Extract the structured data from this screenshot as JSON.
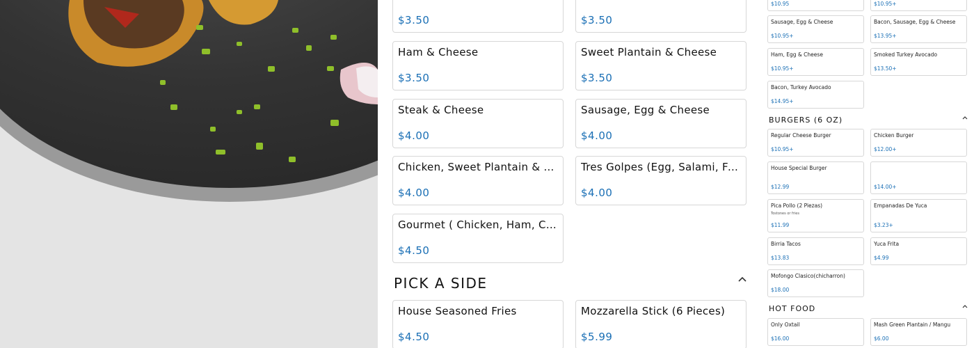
{
  "middle": {
    "items": [
      {
        "name": "",
        "price": "$3.50"
      },
      {
        "name": "",
        "price": "$3.50"
      },
      {
        "name": "Ham & Cheese",
        "price": "$3.50"
      },
      {
        "name": "Sweet Plantain & Cheese",
        "price": "$3.50"
      },
      {
        "name": "Steak & Cheese",
        "price": "$4.00"
      },
      {
        "name": "Sausage, Egg & Cheese",
        "price": "$4.00"
      },
      {
        "name": "Chicken, Sweet Plantain & Cheese",
        "price": "$4.00"
      },
      {
        "name": "Tres Golpes (Egg, Salami, Fried Cheese)",
        "price": "$4.00"
      },
      {
        "name": "Gourmet ( Chicken, Ham, Corn & Cheese)",
        "price": "$4.50"
      }
    ],
    "side_section": {
      "title": "PICK A SIDE",
      "items": [
        {
          "name": "House Seasoned Fries",
          "price": "$4.50"
        },
        {
          "name": "Mozzarella Stick (6 Pieces)",
          "price": "$5.99"
        }
      ]
    }
  },
  "right": {
    "top_items": [
      {
        "name": "",
        "price": "$10.95"
      },
      {
        "name": "",
        "price": "$10.95+"
      },
      {
        "name": "Sausage, Egg & Cheese",
        "price": "$10.95+"
      },
      {
        "name": "Bacon, Sausage, Egg & Cheese",
        "price": "$13.95+"
      },
      {
        "name": "Ham, Egg & Cheese",
        "price": "$10.95+"
      },
      {
        "name": "Smoked Turkey Avocado",
        "price": "$13.50+"
      },
      {
        "name": "Bacon, Turkey Avocado",
        "price": "$14.95+"
      }
    ],
    "burgers": {
      "title": "BURGERS (6 OZ)",
      "items": [
        {
          "name": "Regular Cheese Burger",
          "price": "$10.95+"
        },
        {
          "name": "Chicken Burger",
          "price": "$12.00+"
        },
        {
          "name": "House Special Burger",
          "price": "$12.99"
        },
        {
          "name": "",
          "price": "$14.00+"
        },
        {
          "name": "Pica Pollo (2 Piezas)",
          "desc": "Tostones or fries",
          "price": "$11.99"
        },
        {
          "name": "Empanadas De Yuca",
          "price": "$3.23+"
        },
        {
          "name": "Birria Tacos",
          "price": "$13.83"
        },
        {
          "name": "Yuca Frita",
          "price": "$4.99"
        },
        {
          "name": "Mofongo Clasico(chicharron)",
          "price": "$18.00"
        }
      ]
    },
    "hot_food": {
      "title": "HOT FOOD",
      "items": [
        {
          "name": "Only Oxtail",
          "price": "$16.00"
        },
        {
          "name": "Mash Green Plantain / Mangu",
          "price": "$6.00"
        }
      ]
    }
  },
  "icons": {
    "collapse": "chevron-up-icon"
  }
}
